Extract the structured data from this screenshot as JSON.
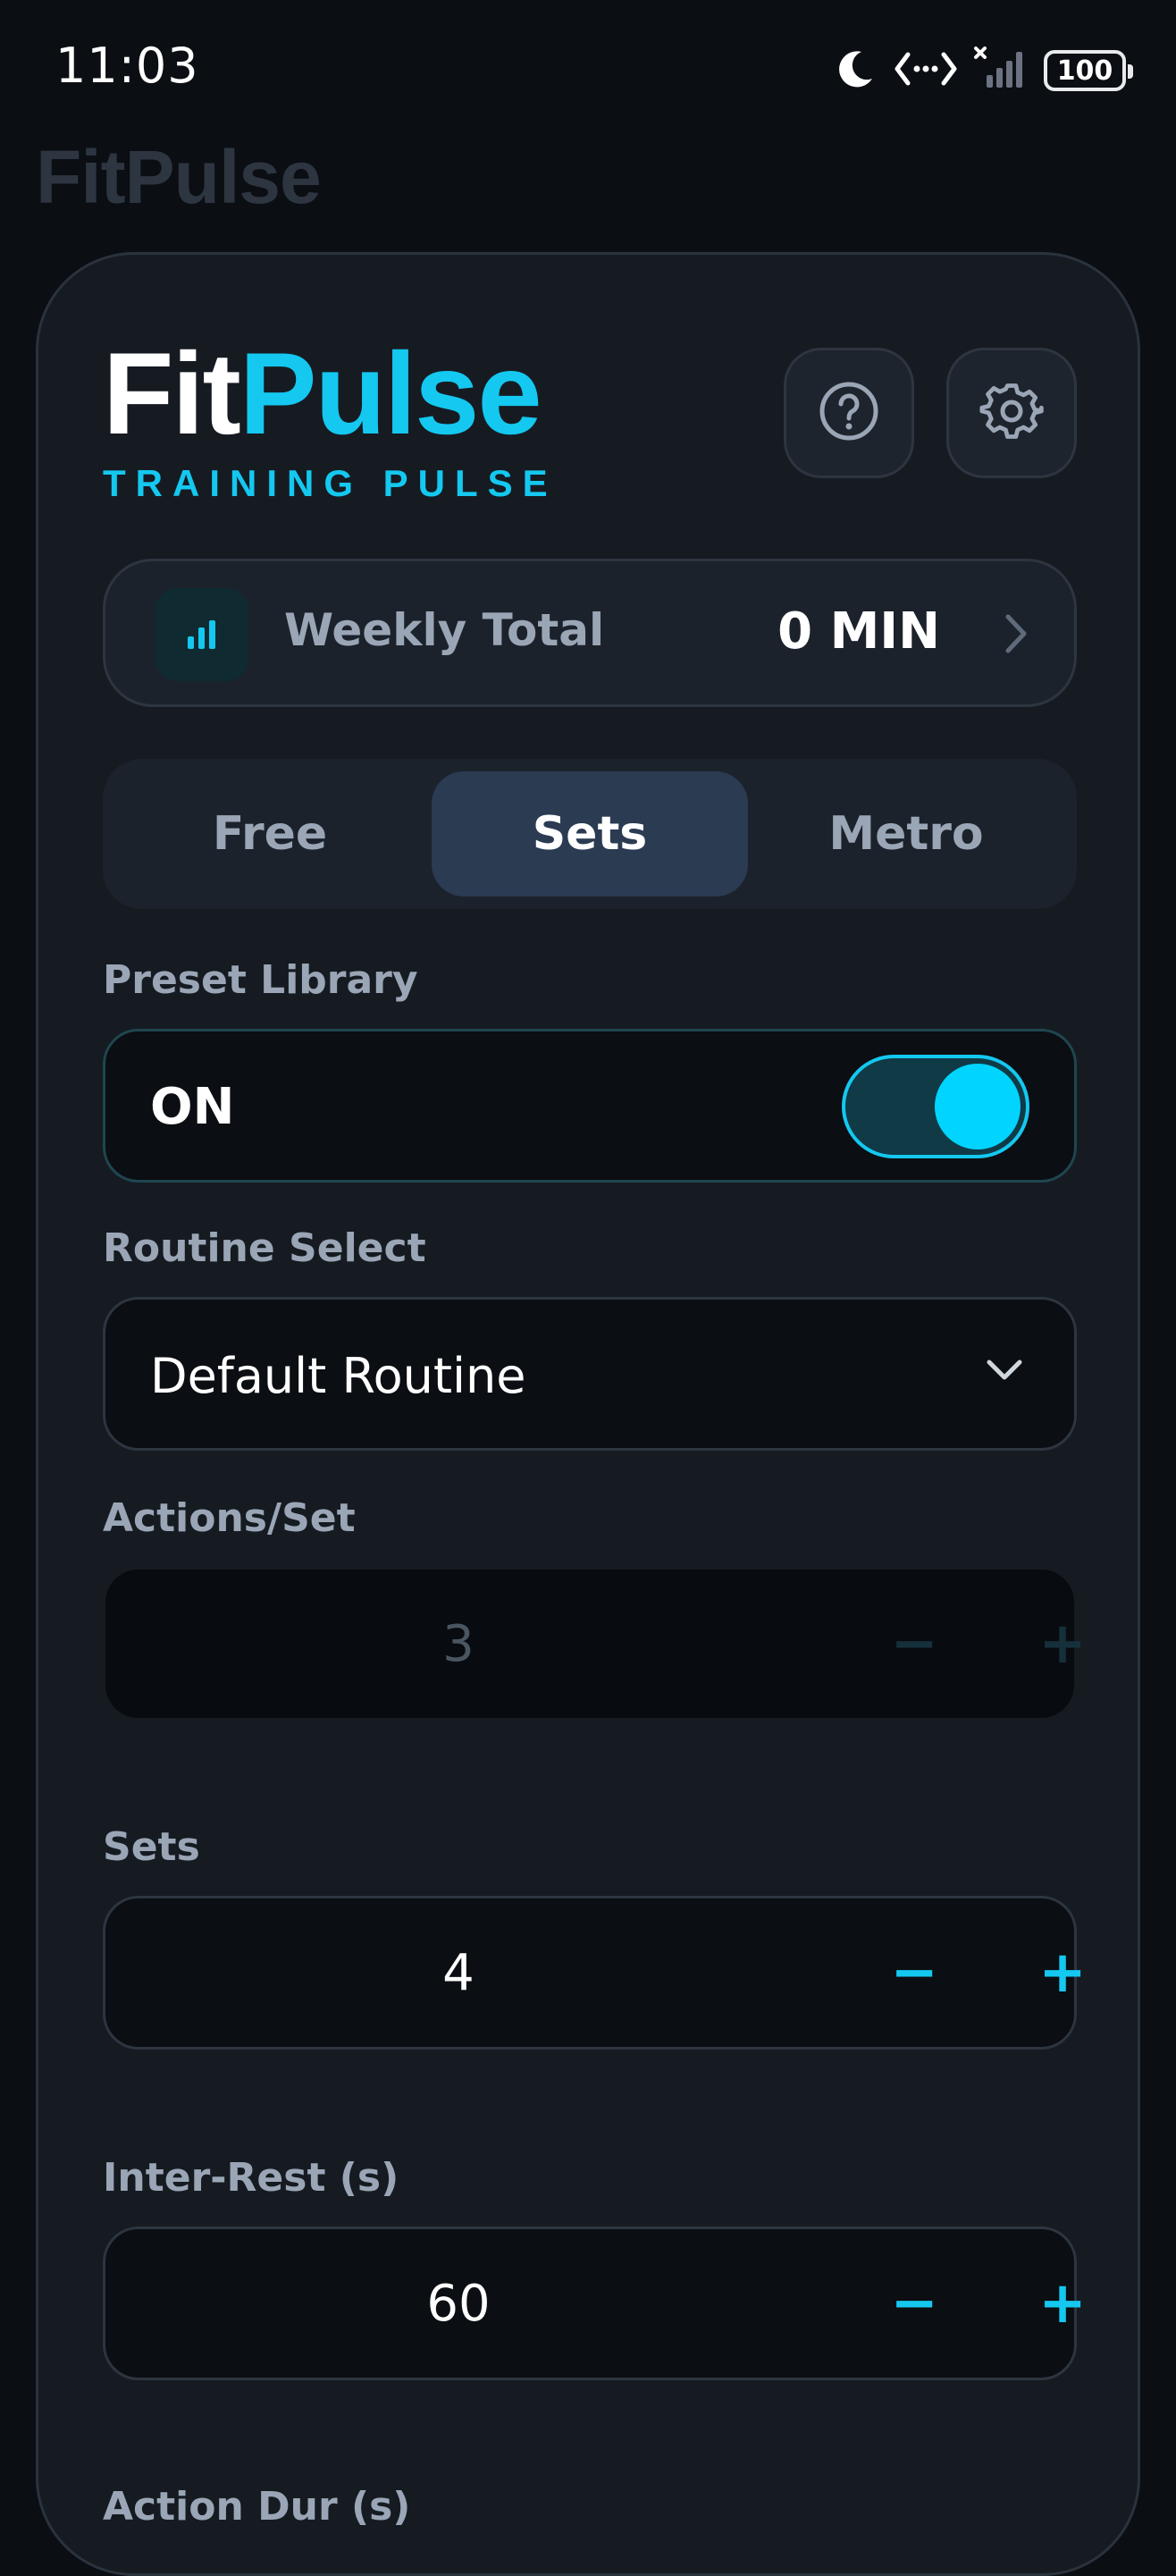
{
  "status_bar": {
    "time": "11:03",
    "battery": "100"
  },
  "ghost_title": "FitPulse",
  "brand": {
    "fit": "Fit",
    "pulse": "Pulse",
    "subtitle": "TRAINING PULSE",
    "accent_color": "#14c8f0"
  },
  "weekly": {
    "label": "Weekly Total",
    "value": "0 MIN"
  },
  "tabs": [
    {
      "label": "Free",
      "active": false
    },
    {
      "label": "Sets",
      "active": true
    },
    {
      "label": "Metro",
      "active": false
    }
  ],
  "preset": {
    "label": "Preset Library",
    "state_text": "ON",
    "enabled": true
  },
  "routine": {
    "label": "Routine Select",
    "value": "Default Routine"
  },
  "actions_per_set": {
    "label": "Actions/Set",
    "value": "3",
    "disabled": true,
    "minus": "−",
    "plus": "+"
  },
  "sets": {
    "label": "Sets",
    "value": "4",
    "minus": "−",
    "plus": "+"
  },
  "inter_rest": {
    "label": "Inter-Rest (s)",
    "value": "60",
    "minus": "−",
    "plus": "+"
  },
  "action_dur": {
    "label": "Action Dur (s)"
  }
}
